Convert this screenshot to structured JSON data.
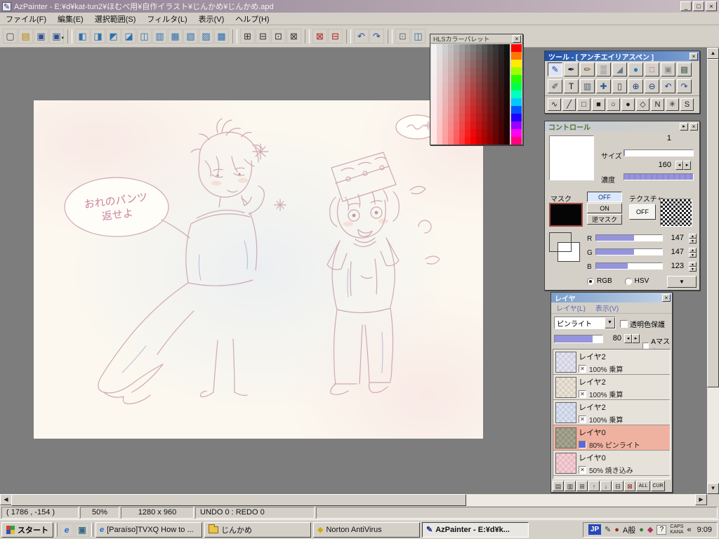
{
  "window": {
    "title": "AzPainter - E:¥d¥kat-tun2¥ほむべ用¥自作イラスト¥じんかめ¥じんかめ.apd"
  },
  "menu": {
    "items": [
      "ファイル(F)",
      "編集(E)",
      "選択範囲(S)",
      "フィルタ(L)",
      "表示(V)",
      "ヘルプ(H)"
    ],
    "names": [
      "menu-file",
      "menu-edit",
      "menu-select",
      "menu-filter",
      "menu-view",
      "menu-help"
    ]
  },
  "toolbar": {
    "buttons": [
      {
        "name": "new-canvas",
        "glyph": "▢",
        "color": "#404858"
      },
      {
        "name": "open-file",
        "glyph": "▤",
        "color": "#b8860b"
      },
      {
        "name": "save-file",
        "glyph": "▣",
        "color": "#2f4f8f"
      },
      {
        "name": "save-as",
        "glyph": "▣",
        "color": "#2f4f8f",
        "arrow": true
      },
      {
        "sep": true
      },
      {
        "name": "toggle-tool-window",
        "glyph": "◧",
        "color": "#2f6faf"
      },
      {
        "name": "toggle-control-window",
        "glyph": "◨",
        "color": "#2f6faf"
      },
      {
        "name": "toggle-layer-window",
        "glyph": "◩",
        "color": "#2f6faf"
      },
      {
        "name": "toggle-palette-window",
        "glyph": "◪",
        "color": "#2f6faf"
      },
      {
        "name": "toggle-preview-window",
        "glyph": "◫",
        "color": "#2f6faf"
      },
      {
        "name": "toggle-option-window",
        "glyph": "▥",
        "color": "#2f6faf"
      },
      {
        "name": "canvas-scale",
        "glyph": "▦",
        "color": "#2f6faf"
      },
      {
        "name": "canvas-resize",
        "glyph": "▧",
        "color": "#2f6faf"
      },
      {
        "name": "canvas-trim",
        "glyph": "▨",
        "color": "#2f6faf"
      },
      {
        "name": "canvas-rotate",
        "glyph": "▩",
        "color": "#2f6faf"
      },
      {
        "sep": true
      },
      {
        "name": "grid-toggle",
        "glyph": "⊞",
        "color": "#303030"
      },
      {
        "name": "pixel-grid-toggle",
        "glyph": "⊟",
        "color": "#303030"
      },
      {
        "name": "grid-settings",
        "glyph": "⊡",
        "color": "#303030"
      },
      {
        "name": "select-all",
        "glyph": "⊠",
        "color": "#303030"
      },
      {
        "sep": true
      },
      {
        "name": "deselect",
        "glyph": "⊠",
        "color": "#b02020"
      },
      {
        "name": "selection-cancel",
        "glyph": "⊟",
        "color": "#b02020"
      },
      {
        "sep": true
      },
      {
        "name": "undo",
        "glyph": "↶",
        "color": "#2a4a9a"
      },
      {
        "name": "redo",
        "glyph": "↷",
        "color": "#2a4a9a"
      },
      {
        "sep": true
      },
      {
        "name": "stamp",
        "glyph": "⊡",
        "color": "#707070"
      },
      {
        "name": "capture",
        "glyph": "◫",
        "color": "#2a6a9a"
      }
    ]
  },
  "canvas": {
    "bubble_line1": "おれのパンツ",
    "bubble_line2": "返せよ"
  },
  "palette_window": {
    "title": "HLSカラーパレット",
    "rows": 13,
    "cols": 14
  },
  "tool_window": {
    "title": "ツール - [ アンチエイリアスペン ]",
    "rows": [
      {
        "buttons": [
          {
            "name": "antialias-pen-tool",
            "glyph": "✎",
            "color": "#1040c0",
            "selected": true
          },
          {
            "name": "pen-tool",
            "glyph": "✒",
            "color": "#102030"
          },
          {
            "name": "brush-tool",
            "glyph": "✏",
            "color": "#7a4a20"
          },
          {
            "name": "airbrush-tool",
            "glyph": "▒",
            "color": "#5a6a7a"
          },
          {
            "name": "blur-tool",
            "glyph": "◢",
            "color": "#6a7a8a"
          },
          {
            "name": "water-tool",
            "glyph": "●",
            "color": "#2a7ac0"
          },
          {
            "name": "eraser-tool",
            "glyph": "□",
            "color": "#c06a6a"
          },
          {
            "name": "rect-eraser-tool",
            "glyph": "▣",
            "color": "#8a8a8a"
          },
          {
            "name": "texture-brush-tool",
            "glyph": "▩",
            "color": "#5a6a5a"
          }
        ]
      },
      {
        "buttons": [
          {
            "name": "dot-pen-tool",
            "glyph": "✐",
            "color": "#3a4a5a"
          },
          {
            "name": "text-tool",
            "glyph": "T",
            "color": "#101010"
          },
          {
            "name": "gradient-tool",
            "glyph": "▥",
            "color": "#4a5a7a"
          },
          {
            "name": "move-tool",
            "glyph": "✚",
            "color": "#2a5a9a"
          },
          {
            "name": "select-tool",
            "glyph": "▯",
            "color": "#3a3a3a"
          },
          {
            "name": "zoom-in-tool",
            "glyph": "⊕",
            "color": "#1a3a7a"
          },
          {
            "name": "zoom-out-tool",
            "glyph": "⊖",
            "color": "#1a3a7a"
          },
          {
            "name": "undo-tool",
            "glyph": "↶",
            "color": "#2a4a9a"
          },
          {
            "name": "redo-tool",
            "glyph": "↷",
            "color": "#2a4a9a"
          }
        ]
      },
      {
        "shapes": true,
        "buttons": [
          {
            "name": "freehand-shape",
            "glyph": "∿",
            "color": "#202020"
          },
          {
            "name": "line-shape",
            "glyph": "╱",
            "color": "#202020"
          },
          {
            "name": "rect-shape",
            "glyph": "□",
            "color": "#202020"
          },
          {
            "name": "fill-rect-shape",
            "glyph": "■",
            "color": "#202020"
          },
          {
            "name": "ellipse-shape",
            "glyph": "○",
            "color": "#202020"
          },
          {
            "name": "fill-ellipse-shape",
            "glyph": "●",
            "color": "#202020"
          },
          {
            "name": "polygon-shape",
            "glyph": "◇",
            "color": "#202020"
          },
          {
            "name": "polyline-shape",
            "glyph": "N",
            "color": "#202020"
          },
          {
            "name": "burst-shape",
            "glyph": "✳",
            "color": "#202020"
          },
          {
            "name": "spline-shape",
            "glyph": "S",
            "color": "#202020"
          }
        ]
      }
    ]
  },
  "control_panel": {
    "title": "コントロール",
    "pen_value": "1",
    "size_label": "サイズ",
    "size_max": "160",
    "density_label": "濃度",
    "density_percent": 100,
    "mask_label": "マスク",
    "mask_off": "OFF",
    "mask_on": "ON",
    "mask_reverse": "逆マスク",
    "texture_label": "テクスチャ",
    "texture_off": "OFF",
    "swatch_color": "#918d6b",
    "r_label": "R",
    "g_label": "G",
    "b_label": "B",
    "r_value": "147",
    "g_value": "147",
    "b_value": "123",
    "rgb_label": "RGB",
    "hsv_label": "HSV"
  },
  "layer_panel": {
    "title": "レイヤ",
    "menu_items": [
      "レイヤ(L)",
      "表示(V)"
    ],
    "blend_mode": "ピンライト",
    "protect_label": "透明色保護",
    "opacity_value": "80",
    "amask_label": "Aマスク",
    "layers": [
      {
        "name": "レイヤ2",
        "info": "100% 乗算",
        "thumb": "#d8d8ec",
        "vis": "x",
        "selected": false
      },
      {
        "name": "レイヤ2",
        "info": "100% 乗算",
        "thumb": "#e4d8c8",
        "vis": "x",
        "selected": false
      },
      {
        "name": "レイヤ2",
        "info": "100% 乗算",
        "thumb": "#ccd6ec",
        "vis": "x",
        "selected": false
      },
      {
        "name": "レイヤ0",
        "info": "80%  ピンライト",
        "thumb": "#87876b",
        "vis": "blue",
        "selected": true
      },
      {
        "name": "レイヤ0",
        "info": "50%  焼き込み",
        "thumb": "#f2bcc4",
        "vis": "x",
        "selected": false
      }
    ],
    "footer": [
      {
        "name": "new-layer-button",
        "glyph": "▤",
        "color": "#303030"
      },
      {
        "name": "duplicate-layer-button",
        "glyph": "▥",
        "color": "#303030"
      },
      {
        "name": "merge-layer-button",
        "glyph": "⊞",
        "color": "#303030"
      },
      {
        "name": "move-layer-up-button",
        "glyph": "↑",
        "color": "#1a3ac0"
      },
      {
        "name": "move-layer-down-button",
        "glyph": "↓",
        "color": "#1a3ac0"
      },
      {
        "name": "combine-layer-button",
        "glyph": "⊟",
        "color": "#303030"
      },
      {
        "name": "delete-layer-button",
        "glyph": "⊠",
        "color": "#902020"
      },
      {
        "name": "show-all-layers-button",
        "glyph": "ALL",
        "color": "#101010",
        "wide": true
      },
      {
        "name": "show-current-layer-button",
        "glyph": "CUR",
        "color": "#101010",
        "wide": true
      }
    ]
  },
  "statusbar": {
    "coords": "( 1786 , -154 )",
    "zoom": "50%",
    "dimensions": "1280 x  960",
    "undo_redo": "UNDO  0 : REDO  0"
  },
  "taskbar": {
    "start_label": "スタート",
    "quick_launch": [
      {
        "name": "ie-quick-launch",
        "glyph": "e",
        "color": "#2a6ad0"
      },
      {
        "name": "show-desktop-quick-launch",
        "glyph": "▣",
        "color": "#3a6a8a"
      }
    ],
    "tasks": [
      {
        "name": "task-ie",
        "label": "[Paraíso]TVXQ How to ...",
        "icon": "e",
        "icon_color": "#2a6ad0",
        "active": false
      },
      {
        "name": "task-folder",
        "label": "じんかめ",
        "icon": "folder",
        "icon_color": "#ecc34a",
        "active": false
      },
      {
        "name": "task-norton",
        "label": "Norton AntiVirus",
        "icon": "◆",
        "icon_color": "#d8a800",
        "active": false
      },
      {
        "name": "task-azpainter",
        "label": "AzPainter - E:¥d¥k...",
        "icon": "✎",
        "icon_color": "#203080",
        "active": true
      }
    ],
    "tray": {
      "jp": "JP",
      "ime_mode": "A般",
      "caps": "CAPS",
      "kana": "KANA",
      "chevron": "«",
      "time": "9:09"
    }
  }
}
